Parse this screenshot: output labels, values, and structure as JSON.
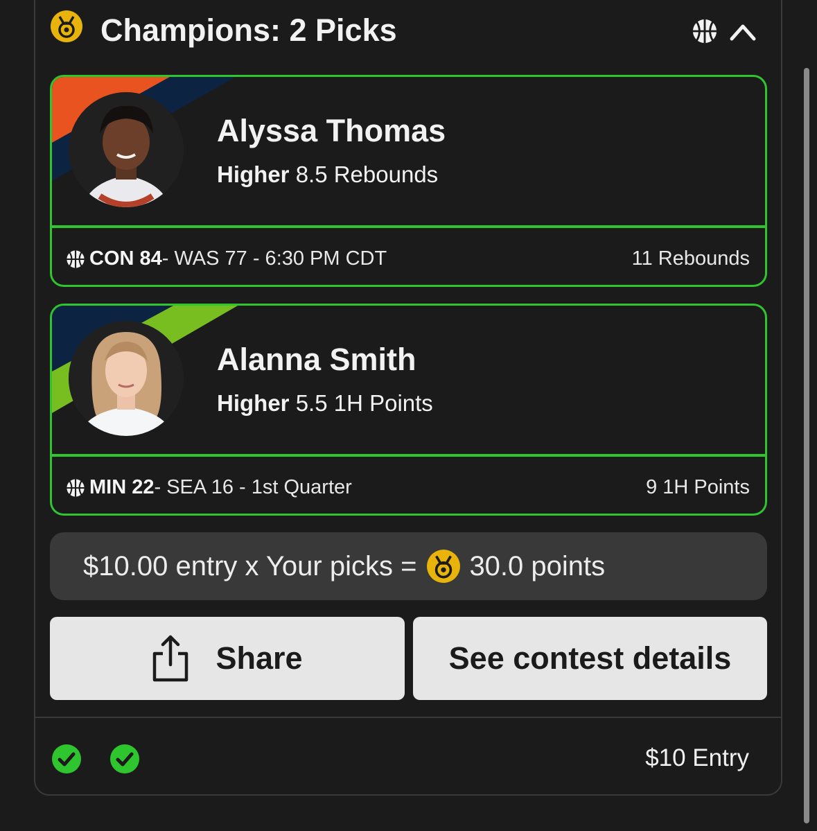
{
  "header": {
    "title": "Champions: 2 Picks",
    "sport_icon": "basketball-icon",
    "collapse_icon": "chevron-up-icon",
    "medal_icon": "medal-icon"
  },
  "picks": [
    {
      "player_name": "Alyssa Thomas",
      "direction": "Higher",
      "line": "8.5 Rebounds",
      "team_abbr": "CON",
      "team_score": "84",
      "game_rest": " - WAS 77 - 6:30 PM CDT",
      "result": "11 Rebounds",
      "team_colors": [
        "#e8531f",
        "#0c2341"
      ]
    },
    {
      "player_name": "Alanna Smith",
      "direction": "Higher",
      "line": "5.5 1H Points",
      "team_abbr": "MIN",
      "team_score": "22",
      "game_rest": " - SEA 16 - 1st Quarter",
      "result": "9 1H Points",
      "team_colors": [
        "#0c2341",
        "#78be20"
      ]
    }
  ],
  "summary": {
    "prefix": "$10.00 entry x Your picks =",
    "points": "30.0 points"
  },
  "buttons": {
    "share_label": "Share",
    "details_label": "See contest details"
  },
  "footer": {
    "status_icons": [
      "check-circle-icon",
      "check-circle-icon"
    ],
    "entry_label": "$10 Entry"
  },
  "colors": {
    "win_green": "#2ec52e",
    "medal_gold": "#e8b40c",
    "background": "#1b1b1b",
    "button_bg": "#e6e6e6"
  }
}
